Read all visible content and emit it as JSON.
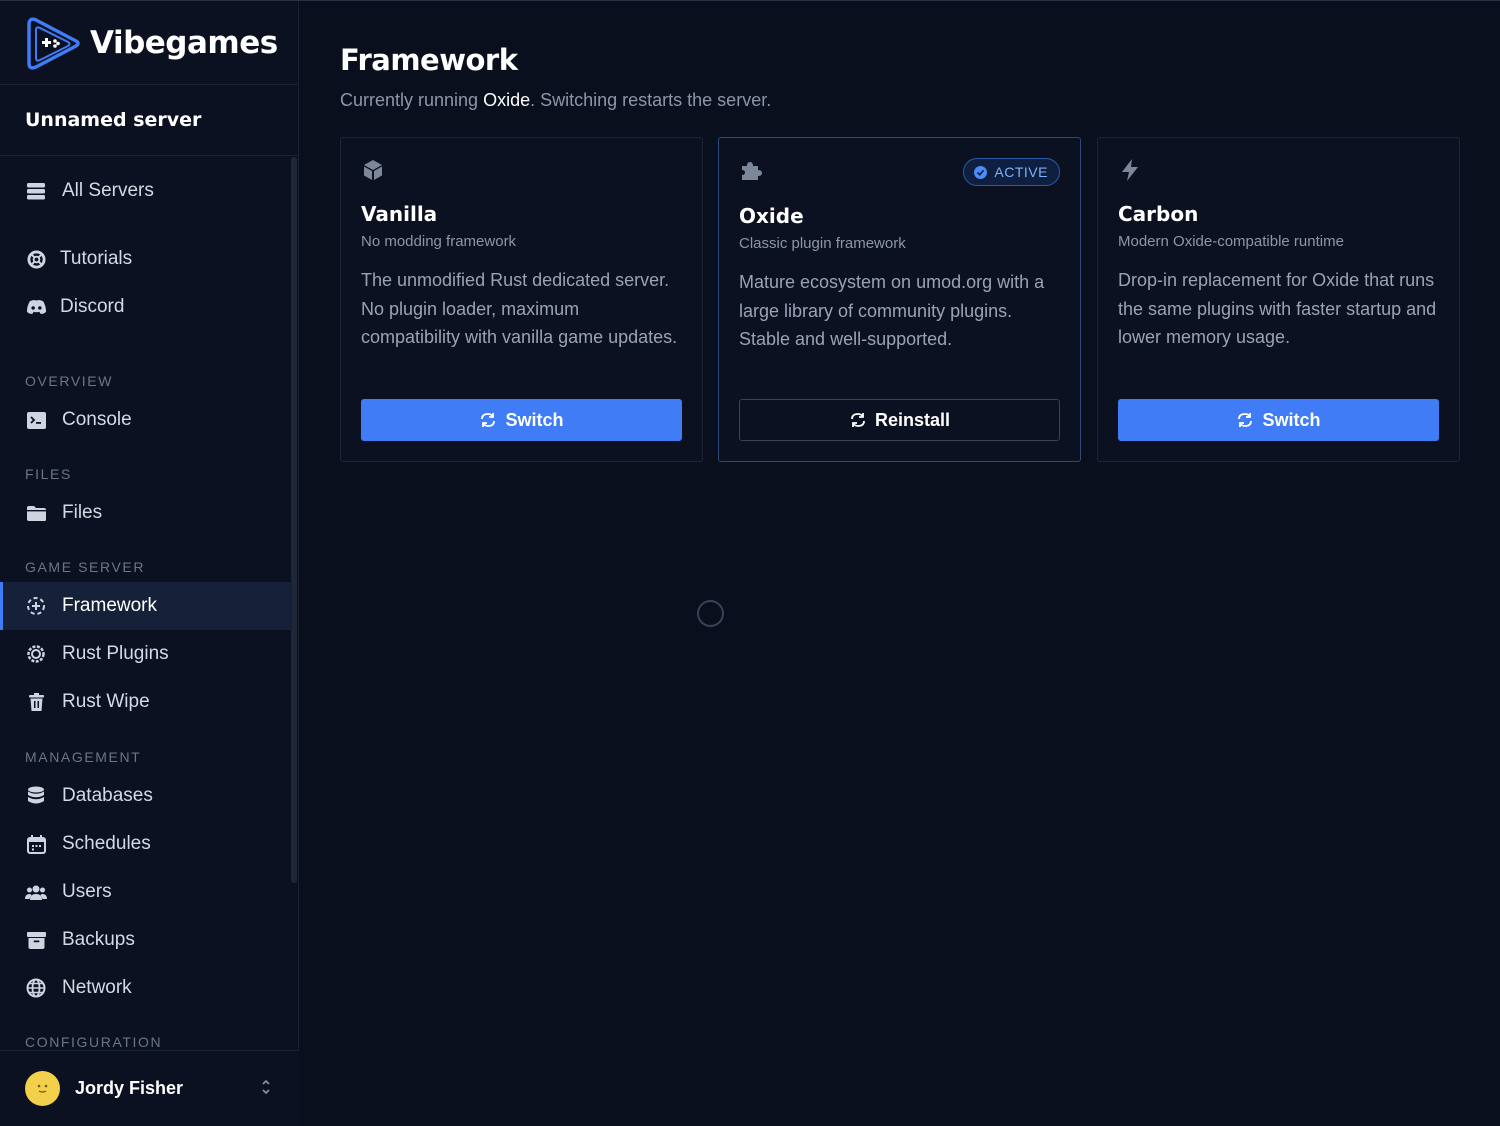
{
  "brand": {
    "name": "Vibegames"
  },
  "server": {
    "name": "Unnamed server"
  },
  "nav": {
    "all_servers": "All Servers",
    "tutorials": "Tutorials",
    "discord": "Discord",
    "sections": {
      "overview": "OVERVIEW",
      "files": "FILES",
      "game_server": "GAME SERVER",
      "management": "MANAGEMENT",
      "configuration": "CONFIGURATION"
    },
    "console": "Console",
    "files": "Files",
    "framework": "Framework",
    "rust_plugins": "Rust Plugins",
    "rust_wipe": "Rust Wipe",
    "databases": "Databases",
    "schedules": "Schedules",
    "users": "Users",
    "backups": "Backups",
    "network": "Network",
    "active_item": "Framework"
  },
  "user": {
    "name": "Jordy Fisher"
  },
  "page": {
    "title": "Framework",
    "subtitle_prefix": "Currently running ",
    "subtitle_current": "Oxide",
    "subtitle_suffix": ". Switching restarts the server."
  },
  "frameworks": [
    {
      "name": "Vanilla",
      "tagline": "No modding framework",
      "description": "The unmodified Rust dedicated server. No plugin loader, maximum compatibility with vanilla game updates.",
      "button": "Switch",
      "icon": "cube-icon",
      "active": false
    },
    {
      "name": "Oxide",
      "tagline": "Classic plugin framework",
      "description": "Mature ecosystem on umod.org with a large library of community plugins. Stable and well-supported.",
      "button": "Reinstall",
      "badge": "ACTIVE",
      "icon": "puzzle-icon",
      "active": true
    },
    {
      "name": "Carbon",
      "tagline": "Modern Oxide-compatible runtime",
      "description": "Drop-in replacement for Oxide that runs the same plugins with faster startup and lower memory usage.",
      "button": "Switch",
      "icon": "bolt-icon",
      "active": false
    }
  ],
  "colors": {
    "background": "#0a0f1e",
    "sidebar": "#0b1120",
    "accent": "#3f7cf5",
    "active_badge": "#7fb0ff"
  }
}
